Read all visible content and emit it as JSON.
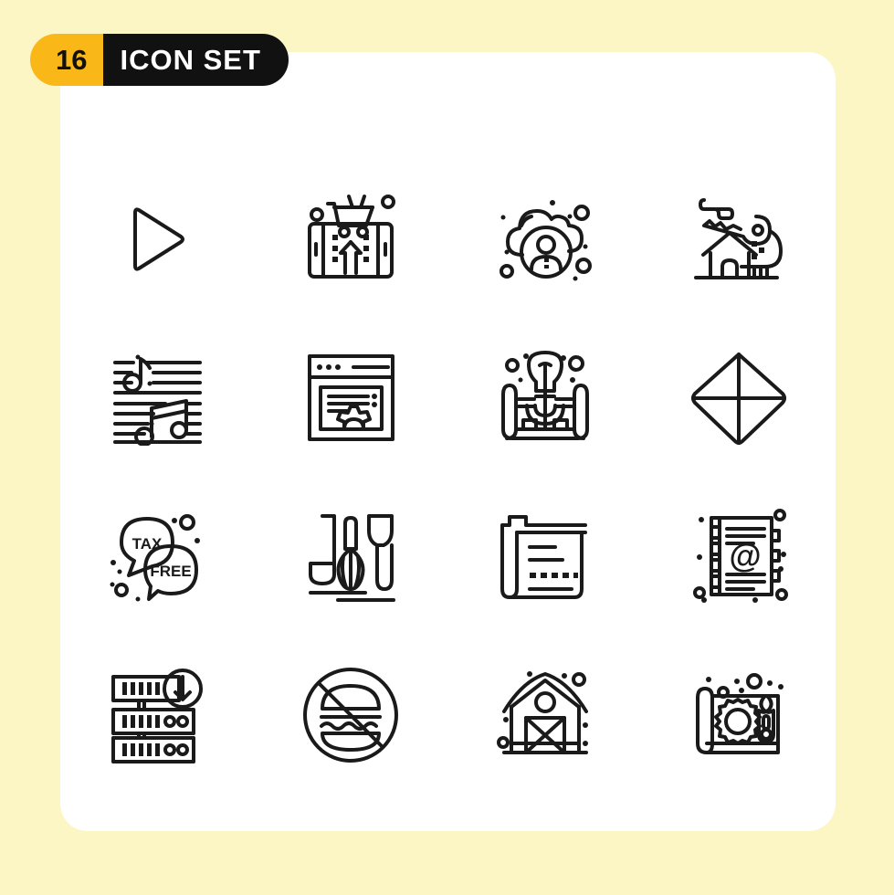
{
  "badge": {
    "count": "16",
    "title": "ICON SET",
    "count_bg": "#F9B718",
    "title_bg": "#111111",
    "title_color": "#FFFFFF"
  },
  "canvas": {
    "background": "#FCF5C4",
    "card_background": "#FFFFFF",
    "stroke_color": "#1a1a1a"
  },
  "icons": [
    {
      "position": 1,
      "row": 1,
      "col": 1,
      "name": "play-icon",
      "label": "Play"
    },
    {
      "position": 2,
      "row": 1,
      "col": 2,
      "name": "mobile-shopping-icon",
      "label": "Mobile Shopping"
    },
    {
      "position": 3,
      "row": 1,
      "col": 3,
      "name": "cloud-user-icon",
      "label": "Cloud User"
    },
    {
      "position": 4,
      "row": 1,
      "col": 4,
      "name": "house-key-icon",
      "label": "House Key"
    },
    {
      "position": 5,
      "row": 2,
      "col": 1,
      "name": "music-notes-icon",
      "label": "Music Notes"
    },
    {
      "position": 6,
      "row": 2,
      "col": 2,
      "name": "browser-settings-icon",
      "label": "Browser Settings"
    },
    {
      "position": 7,
      "row": 2,
      "col": 3,
      "name": "blueprint-idea-icon",
      "label": "Blueprint Idea"
    },
    {
      "position": 8,
      "row": 2,
      "col": 4,
      "name": "kite-icon",
      "label": "Kite"
    },
    {
      "position": 9,
      "row": 3,
      "col": 1,
      "name": "tax-free-bubbles-icon",
      "label": "Tax Free"
    },
    {
      "position": 10,
      "row": 3,
      "col": 2,
      "name": "kitchen-utensils-icon",
      "label": "Kitchen Utensils"
    },
    {
      "position": 11,
      "row": 3,
      "col": 3,
      "name": "folder-document-icon",
      "label": "Folder Document"
    },
    {
      "position": 12,
      "row": 3,
      "col": 4,
      "name": "address-book-icon",
      "label": "Address Book"
    },
    {
      "position": 13,
      "row": 4,
      "col": 1,
      "name": "server-download-icon",
      "label": "Server Download"
    },
    {
      "position": 14,
      "row": 4,
      "col": 2,
      "name": "no-fast-food-icon",
      "label": "No Fast Food"
    },
    {
      "position": 15,
      "row": 4,
      "col": 3,
      "name": "barn-icon",
      "label": "Barn"
    },
    {
      "position": 16,
      "row": 4,
      "col": 4,
      "name": "blueprint-tools-icon",
      "label": "Blueprint Tools"
    }
  ],
  "icon_text": {
    "tax": "TAX",
    "free": "FREE",
    "at_symbol": "@"
  }
}
